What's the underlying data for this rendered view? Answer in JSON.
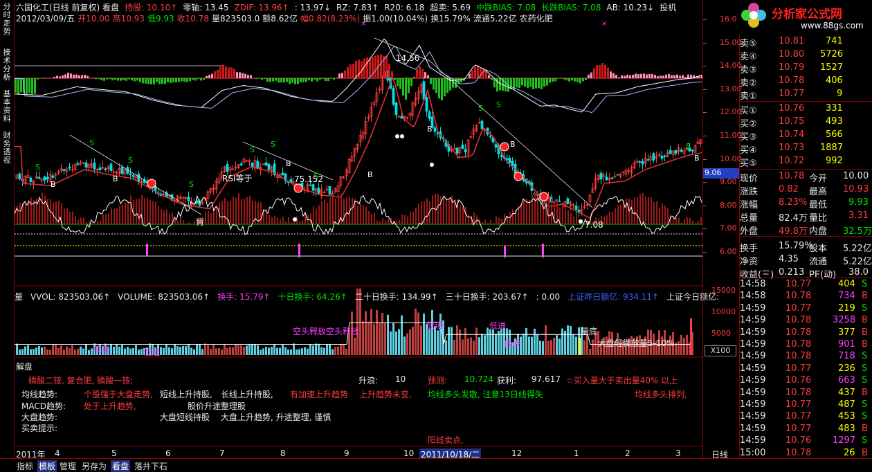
{
  "left_tabs": [
    {
      "label": "分时走势",
      "active": false
    },
    {
      "label": "技术分析",
      "active": true
    },
    {
      "label": "基本资料",
      "active": false
    },
    {
      "label": "财务透视",
      "active": false
    }
  ],
  "header": {
    "line1": [
      {
        "text": "六国化工(日线 前复权) 看盘",
        "color": "#e8e8e8"
      },
      {
        "text": "持股: 10.10↑",
        "color": "#ff3c3c"
      },
      {
        "text": "零轴: 13.45",
        "color": "#e8e8e8"
      },
      {
        "text": "ZDIF: 13.96↑",
        "color": "#ff3c3c"
      },
      {
        "text": ": 13.97↓",
        "color": "#e8e8e8"
      },
      {
        "text": "RZ: 7.83↑",
        "color": "#e8e8e8"
      },
      {
        "text": "R20: 6.18",
        "color": "#e8e8e8"
      },
      {
        "text": "超卖: 5.69",
        "color": "#e8e8e8"
      },
      {
        "text": "中跌BIAS: 7.08",
        "color": "#00e000"
      },
      {
        "text": "长跌BIAS: 7.08",
        "color": "#00e000"
      },
      {
        "text": "AB: 10.23↓",
        "color": "#e8e8e8"
      },
      {
        "text": "投机",
        "color": "#e8e8e8"
      }
    ],
    "line2": [
      {
        "text": "2012/03/09/五",
        "color": "#e8e8e8"
      },
      {
        "text": "开10.00",
        "color": "#ff3c3c"
      },
      {
        "text": "高10.93",
        "color": "#ff3c3c"
      },
      {
        "text": "低9.93",
        "color": "#00e000"
      },
      {
        "text": "收10.78",
        "color": "#ff3c3c"
      },
      {
        "text": "量823503.0",
        "color": "#e8e8e8"
      },
      {
        "text": "额8.62亿",
        "color": "#e8e8e8"
      },
      {
        "text": "幅0.82(8.23%)",
        "color": "#ff3c3c"
      },
      {
        "text": "振1.00(10.04%)",
        "color": "#e8e8e8"
      },
      {
        "text": "换15.79%",
        "color": "#e8e8e8"
      },
      {
        "text": "流通5.22亿",
        "color": "#e8e8e8"
      },
      {
        "text": "农药化肥",
        "color": "#e8e8e8"
      }
    ]
  },
  "price_axis": [
    "16.0",
    "15.00",
    "14.00",
    "13.00",
    "12.00",
    "11.00",
    "10.00",
    "9.00",
    "8.00",
    "7.00",
    "6.00"
  ],
  "price_axis_ticks": [
    16,
    15,
    14,
    13,
    12,
    11,
    10,
    9,
    8,
    7,
    6
  ],
  "current_price_tag": "9.06",
  "chart_annotations": {
    "peak_label": "14.56",
    "rsi_label": "RSI等于",
    "rsi_value": "75.152",
    "low_label": "7.08",
    "bei_label": "背"
  },
  "volume_header": [
    {
      "text": "量",
      "color": "#e8e8e8"
    },
    {
      "text": "VVOL: 823503.06↑",
      "color": "#e8e8e8"
    },
    {
      "text": "VOLUME: 823503.06↑",
      "color": "#e8e8e8"
    },
    {
      "text": "换手: 15.79↑",
      "color": "#ff40ff"
    },
    {
      "text": "十日换手: 64.26↑",
      "color": "#00e000"
    },
    {
      "text": "二十日换手: 134.99↑",
      "color": "#e8e8e8"
    },
    {
      "text": "三十日换手: 203.67↑",
      "color": "#e8e8e8"
    },
    {
      "text": ": 0.00",
      "color": "#e8e8e8"
    },
    {
      "text": "上证昨日额亿: 934.11↑",
      "color": "#4060ff"
    },
    {
      "text": "上证今日额亿:",
      "color": "#e8e8e8"
    }
  ],
  "volume_axis": [
    "15000",
    "10000",
    "5000"
  ],
  "volume_axis_ticks": [
    15000,
    10000,
    5000
  ],
  "volume_unit": "X100",
  "volume_annotations": [
    {
      "text": "低进",
      "color": "#ff40ff"
    },
    {
      "text": "低进",
      "color": "#ff40ff"
    },
    {
      "text": "空头释放空头释放",
      "color": "#ff40ff"
    },
    {
      "text": "低进",
      "color": "#ff40ff"
    },
    {
      "text": "低进",
      "color": "#ff40ff"
    },
    {
      "text": "低进",
      "color": "#ff40ff"
    },
    {
      "text": "量底",
      "color": "#e8e8e8"
    },
    {
      "text": "大盘轻微放量5-10%",
      "color": "#e8e8e8"
    }
  ],
  "analysis": {
    "title": "解盘",
    "sector": "磷酸二铵, 复合肥, 磷酸一铵;",
    "shengliang_label": "升浪:",
    "shengliang_value": "10",
    "yuce_label": "预测:",
    "yuce_value": "10.724",
    "huoli_label": "获利:",
    "huoli_value": "97.617",
    "star_note": "☆买入量大于卖出量40% 以上",
    "row1_label": "均线趋势:",
    "row1_items": [
      {
        "text": "个股强于大盘走势,",
        "color": "#ff3c3c"
      },
      {
        "text": "短线上升持股,",
        "color": "#e8e8e8"
      },
      {
        "text": "长线上升持股,",
        "color": "#e8e8e8"
      },
      {
        "text": "有加速上升趋势",
        "color": "#ff3c3c"
      },
      {
        "text": "上升趋势未变,",
        "color": "#ff3c3c"
      },
      {
        "text": "均线多头发散, 注意13日线得失",
        "color": "#00e000"
      },
      {
        "text": "均线多头排列,",
        "color": "#ff3c3c"
      }
    ],
    "row2_label": "MACD趋势:",
    "row2_items": [
      {
        "text": "处于上升趋势,",
        "color": "#ff3c3c"
      },
      {
        "text": "股价升途整理股",
        "color": "#e8e8e8"
      }
    ],
    "row3_label": "大盘趋势:",
    "row3_items": [
      {
        "text": "大盘短线持股",
        "color": "#e8e8e8"
      },
      {
        "text": "大盘上升趋势, 升途整理, 谨慎",
        "color": "#e8e8e8"
      }
    ],
    "row4_label": "买卖提示:",
    "row5_item": "阳线卖点,"
  },
  "date_axis": {
    "labels": [
      "2011年",
      "4",
      "5",
      "6",
      "7",
      "8",
      "9",
      "10",
      "2011/10/18/二",
      "12",
      "1",
      "2",
      "3"
    ],
    "period": "日线"
  },
  "bottom_tabs": [
    {
      "label": "指标",
      "active": false
    },
    {
      "label": "模板",
      "active": true
    },
    {
      "label": "管理",
      "active": false
    },
    {
      "label": "另存为",
      "active": false
    },
    {
      "label": "看盘",
      "active": true
    },
    {
      "label": "落井下石",
      "active": false
    }
  ],
  "logo": {
    "text": "分析家公式网",
    "url": "www.88gs.com"
  },
  "order_book": {
    "sell": [
      {
        "label": "卖⑤",
        "price": "10.81",
        "vol": "741"
      },
      {
        "label": "卖④",
        "price": "10.80",
        "vol": "5726"
      },
      {
        "label": "卖③",
        "price": "10.79",
        "vol": "1527"
      },
      {
        "label": "卖②",
        "price": "10.78",
        "vol": "406"
      },
      {
        "label": "卖①",
        "price": "10.77",
        "vol": "9"
      }
    ],
    "buy": [
      {
        "label": "买①",
        "price": "10.76",
        "vol": "331"
      },
      {
        "label": "买②",
        "price": "10.75",
        "vol": "493"
      },
      {
        "label": "买③",
        "price": "10.74",
        "vol": "566"
      },
      {
        "label": "买④",
        "price": "10.73",
        "vol": "1887"
      },
      {
        "label": "买⑤",
        "price": "10.72",
        "vol": "992"
      }
    ]
  },
  "quote": [
    {
      "l1": "现价",
      "v1": "10.78",
      "c1": "#ff3c3c",
      "l2": "今开",
      "v2": "10.00",
      "c2": "#e8e8e8"
    },
    {
      "l1": "涨跌",
      "v1": "0.82",
      "c1": "#ff3c3c",
      "l2": "最高",
      "v2": "10.93",
      "c2": "#ff3c3c"
    },
    {
      "l1": "涨幅",
      "v1": "8.23%",
      "c1": "#ff3c3c",
      "l2": "最低",
      "v2": "9.93",
      "c2": "#00e000"
    },
    {
      "l1": "总量",
      "v1": "82.4万",
      "c1": "#e8e8e8",
      "l2": "量比",
      "v2": "3.31",
      "c2": "#ff3c3c"
    },
    {
      "l1": "外盘",
      "v1": "49.8万",
      "c1": "#ff3c3c",
      "l2": "内盘",
      "v2": "32.5万",
      "c2": "#00e000"
    },
    {
      "l1": "换手",
      "v1": "15.79%",
      "c1": "#e8e8e8",
      "l2": "股本",
      "v2": "5.22亿",
      "c2": "#e8e8e8"
    },
    {
      "l1": "净资",
      "v1": "4.35",
      "c1": "#e8e8e8",
      "l2": "流通",
      "v2": "5.22亿",
      "c2": "#e8e8e8"
    },
    {
      "l1": "收益(三)",
      "v1": "0.213",
      "c1": "#e8e8e8",
      "l2": "PE(动)",
      "v2": "38.0",
      "c2": "#e8e8e8"
    }
  ],
  "ticks": [
    {
      "time": "14:58",
      "price": "10.77",
      "vol": "404",
      "side": "S"
    },
    {
      "time": "14:58",
      "price": "10.78",
      "vol": "734",
      "side": "B"
    },
    {
      "time": "14:59",
      "price": "10.77",
      "vol": "219",
      "side": "S"
    },
    {
      "time": "14:59",
      "price": "10.78",
      "vol": "3258",
      "side": "B"
    },
    {
      "time": "14:59",
      "price": "10.78",
      "vol": "377",
      "side": "B"
    },
    {
      "time": "14:59",
      "price": "10.78",
      "vol": "901",
      "side": "B"
    },
    {
      "time": "14:59",
      "price": "10.78",
      "vol": "718",
      "side": "S"
    },
    {
      "time": "14:59",
      "price": "10.77",
      "vol": "236",
      "side": "S"
    },
    {
      "time": "14:59",
      "price": "10.76",
      "vol": "663",
      "side": "S"
    },
    {
      "time": "14:59",
      "price": "10.78",
      "vol": "437",
      "side": "B"
    },
    {
      "time": "14:59",
      "price": "10.77",
      "vol": "487",
      "side": "S"
    },
    {
      "time": "14:59",
      "price": "10.77",
      "vol": "453",
      "side": "S"
    },
    {
      "time": "14:59",
      "price": "10.77",
      "vol": "483",
      "side": "B"
    },
    {
      "time": "14:59",
      "price": "10.76",
      "vol": "1297",
      "side": "S"
    },
    {
      "time": "15:00",
      "price": "10.78",
      "vol": "26",
      "side": "B"
    }
  ],
  "colors": {
    "up": "#ff3c3c",
    "down": "#00e0e0",
    "frame": "#8b0000",
    "bg": "#000000"
  }
}
